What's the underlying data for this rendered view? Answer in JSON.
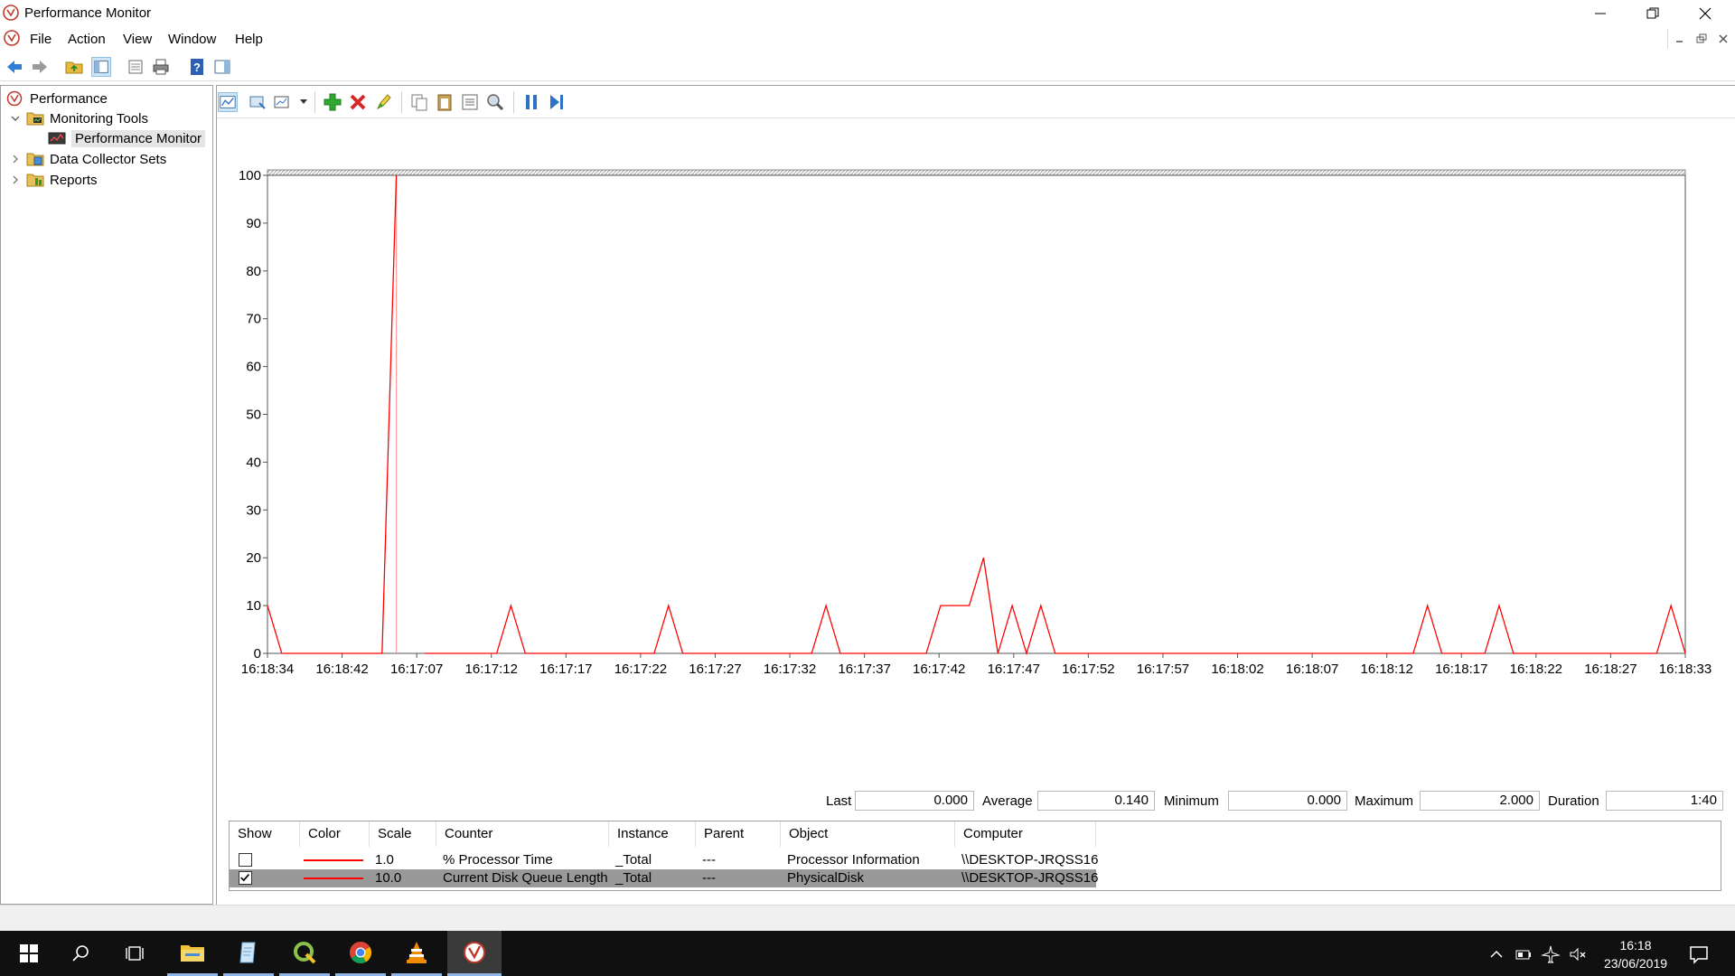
{
  "window": {
    "title": "Performance Monitor",
    "menu": [
      "File",
      "Action",
      "View",
      "Window",
      "Help"
    ]
  },
  "tree": {
    "items": [
      {
        "label": "Performance",
        "icon": "performance-icon"
      },
      {
        "label": "Monitoring Tools",
        "icon": "monitoring-tools-folder-icon"
      },
      {
        "label": "Performance Monitor",
        "icon": "performance-monitor-icon"
      },
      {
        "label": "Data Collector Sets",
        "icon": "data-collector-sets-icon"
      },
      {
        "label": "Reports",
        "icon": "reports-icon"
      }
    ]
  },
  "graph_toolbar": {
    "icons": [
      "view-current-activity-icon",
      "change-graph-type-icon",
      "chart-type-dropdown-icon",
      "add-counter-icon",
      "delete-counter-icon",
      "highlight-icon",
      "copy-properties-icon",
      "paste-counter-list-icon",
      "properties-icon",
      "zoom-icon",
      "freeze-display-icon",
      "update-data-icon"
    ]
  },
  "chart_data": {
    "type": "line",
    "ylim": [
      0,
      100
    ],
    "yticks": [
      "100",
      "90",
      "80",
      "70",
      "60",
      "50",
      "40",
      "30",
      "20",
      "10",
      "0"
    ],
    "xticks": [
      "16:18:34",
      "16:18:42",
      "16:17:07",
      "16:17:12",
      "16:17:17",
      "16:17:22",
      "16:17:27",
      "16:17:32",
      "16:17:37",
      "16:17:42",
      "16:17:47",
      "16:17:52",
      "16:17:57",
      "16:18:02",
      "16:18:07",
      "16:18:12",
      "16:18:17",
      "16:18:22",
      "16:18:27",
      "16:18:33"
    ],
    "grid": false,
    "series": [
      {
        "counter": "Current Disk Queue Length",
        "color": "#ff0000",
        "samples": 100,
        "values": [
          10,
          0,
          0,
          0,
          0,
          0,
          0,
          0,
          0,
          100,
          null,
          0,
          0,
          0,
          0,
          0,
          0,
          10,
          0,
          0,
          0,
          0,
          0,
          0,
          0,
          0,
          0,
          0,
          10,
          0,
          0,
          0,
          0,
          0,
          0,
          0,
          0,
          0,
          0,
          10,
          0,
          0,
          0,
          0,
          0,
          0,
          0,
          10,
          10,
          10,
          20,
          0,
          10,
          0,
          10,
          0,
          0,
          0,
          0,
          0,
          0,
          0,
          0,
          0,
          0,
          0,
          0,
          0,
          0,
          0,
          0,
          0,
          0,
          0,
          0,
          0,
          0,
          0,
          0,
          0,
          0,
          10,
          0,
          0,
          0,
          0,
          10,
          0,
          0,
          0,
          0,
          0,
          0,
          0,
          0,
          0,
          0,
          0,
          10,
          0
        ],
        "current_time_index": 9
      }
    ]
  },
  "stats": {
    "last_label": "Last",
    "last_value": "0.000",
    "average_label": "Average",
    "average_value": "0.140",
    "minimum_label": "Minimum",
    "minimum_value": "0.000",
    "maximum_label": "Maximum",
    "maximum_value": "2.000",
    "duration_label": "Duration",
    "duration_value": "1:40"
  },
  "counters": {
    "headers": [
      "Show",
      "Color",
      "Scale",
      "Counter",
      "Instance",
      "Parent",
      "Object",
      "Computer"
    ],
    "rows": [
      {
        "show": false,
        "color": "#ff0000",
        "scale": "1.0",
        "counter": "% Processor Time",
        "instance": "_Total",
        "parent": "---",
        "object": "Processor Information",
        "computer": "\\\\DESKTOP-JRQSS16"
      },
      {
        "show": true,
        "color": "#ff0000",
        "scale": "10.0",
        "counter": "Current Disk Queue Length",
        "instance": "_Total",
        "parent": "---",
        "object": "PhysicalDisk",
        "computer": "\\\\DESKTOP-JRQSS16"
      }
    ]
  },
  "taskbar": {
    "apps": [
      "windows-start-icon",
      "search-icon",
      "task-view-icon",
      "file-explorer-icon",
      "notepad-icon",
      "quantum-gis-icon",
      "chrome-icon",
      "vlc-icon",
      "performance-monitor-taskbar-icon"
    ],
    "time": "16:18",
    "date": "23/06/2019"
  }
}
